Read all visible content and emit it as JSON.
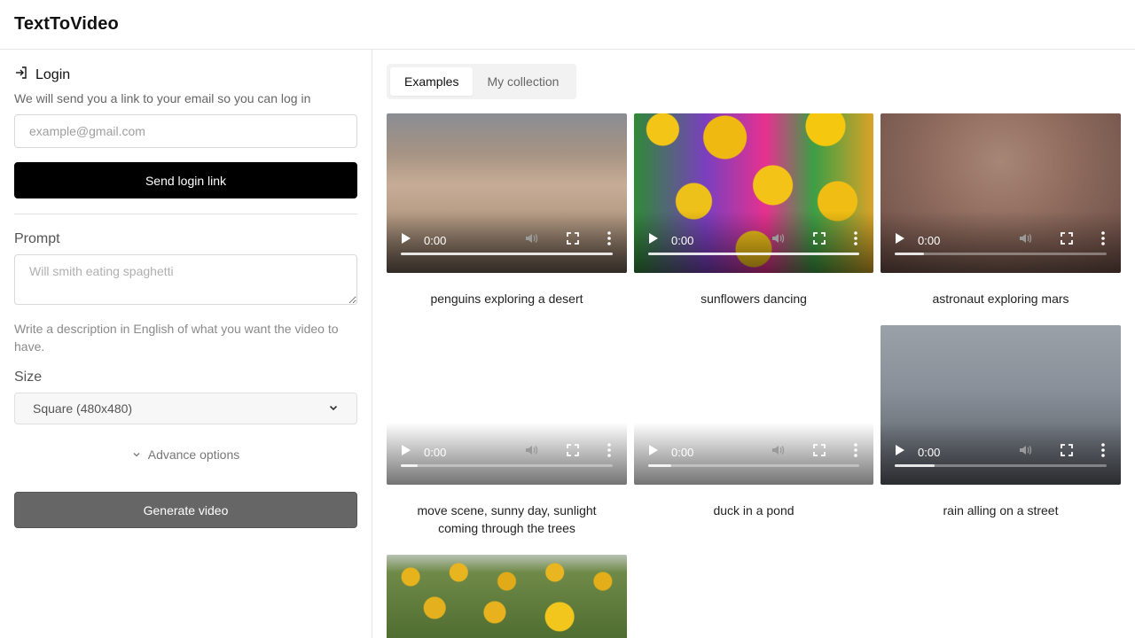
{
  "app": {
    "title": "TextToVideo"
  },
  "login": {
    "title": "Login",
    "description": "We will send you a link to your email so you can log in",
    "email_placeholder": "example@gmail.com",
    "send_button": "Send login link"
  },
  "prompt": {
    "label": "Prompt",
    "placeholder": "Will smith eating spaghetti",
    "hint": "Write a description in English of what you want the video to have."
  },
  "size": {
    "label": "Size",
    "selected": "Square (480x480)"
  },
  "advance": {
    "label": "Advance options"
  },
  "generate": {
    "label": "Generate video"
  },
  "tabs": [
    {
      "label": "Examples",
      "active": true
    },
    {
      "label": "My collection",
      "active": false
    }
  ],
  "videos": [
    {
      "caption": "penguins exploring a desert",
      "time": "0:00",
      "progress": 1.0,
      "thumb": "t-penguin"
    },
    {
      "caption": "sunflowers dancing",
      "time": "0:00",
      "progress": 1.0,
      "thumb": "t-sunflower"
    },
    {
      "caption": "astronaut exploring mars",
      "time": "0:00",
      "progress": 0.14,
      "thumb": "t-astronaut"
    },
    {
      "caption": "move scene, sunny day, sunlight coming through the trees",
      "time": "0:00",
      "progress": 0.08,
      "thumb": "t-white"
    },
    {
      "caption": "duck in a pond",
      "time": "0:00",
      "progress": 0.11,
      "thumb": "t-white"
    },
    {
      "caption": "rain alling on a street",
      "time": "0:00",
      "progress": 0.19,
      "thumb": "t-rain"
    },
    {
      "caption": "",
      "time": "",
      "progress": 0,
      "thumb": "t-field"
    }
  ]
}
